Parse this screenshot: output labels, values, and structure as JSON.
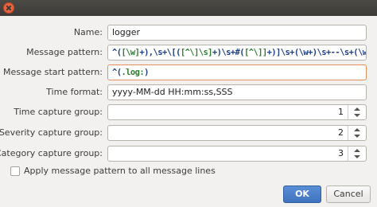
{
  "form": {
    "name_label": "Name:",
    "name_value": "logger",
    "message_pattern_label": "Message pattern:",
    "message_pattern_parts": [
      "^(",
      "[\\w]",
      "+),\\s+\\[(",
      "[^\\]\\s]",
      "+)\\s+#(",
      "[^\\]]",
      "+)]\\s+(\\w+)\\s+--\\s+(\\w+)?:\\s+(.+)$"
    ],
    "message_start_pattern_label": "Message start pattern:",
    "message_start_pattern_parts": [
      "^(",
      ".log:",
      ")"
    ],
    "time_format_label": "Time format:",
    "time_format_value": "yyyy-MM-dd HH:mm:ss,SSS",
    "time_capture_group_label": "Time capture group:",
    "time_capture_group_value": "1",
    "severity_capture_group_label": "Severity capture group:",
    "severity_capture_group_value": "2",
    "category_capture_group_label": "Category capture group:",
    "category_capture_group_value": "3",
    "apply_pattern_label": "Apply message pattern to all message lines",
    "apply_pattern_checked": false
  },
  "buttons": {
    "ok_label": "OK",
    "cancel_label": "Cancel"
  },
  "icons": {
    "close": "close-icon"
  }
}
